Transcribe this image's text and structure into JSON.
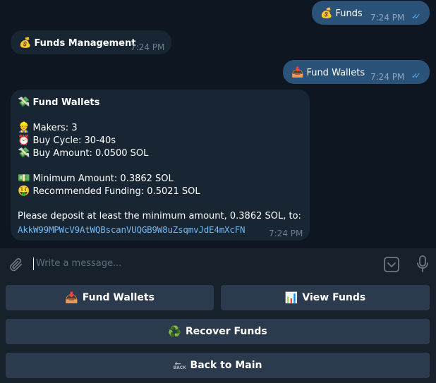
{
  "messages": {
    "m1": {
      "icon": "money-bag-icon",
      "emoji": "💰",
      "text": "Funds",
      "time": "7:24 PM",
      "checks": "✓✓"
    },
    "m2": {
      "icon": "money-bag-icon",
      "emoji": "💰",
      "text": "Funds Management",
      "time": "7:24 PM"
    },
    "m3": {
      "icon": "inbox-tray-icon",
      "emoji": "📥",
      "text": "Fund Wallets",
      "time": "7:24 PM",
      "checks": "✓✓"
    },
    "m4": {
      "title_emoji": "💸",
      "title": "Fund Wallets",
      "makers_emoji": "👷",
      "makers": "Makers: 3",
      "cycle_emoji": "⏰",
      "cycle": "Buy Cycle: 30-40s",
      "amount_emoji": "💸",
      "amount": "Buy Amount: 0.0500 SOL",
      "min_emoji": "💵",
      "min": "Minimum Amount: 0.3862 SOL",
      "rec_emoji": "🤑",
      "rec": "Recommended Funding: 0.5021 SOL",
      "deposit": "Please deposit at least the minimum amount, 0.3862 SOL, to:",
      "address": "AkkW99MPWcV9AtWQBscanVUQGB9W8uZsqmvJdE4mXcFN",
      "time": "7:24 PM"
    }
  },
  "input": {
    "placeholder": "Write a message..."
  },
  "keyboard": {
    "fund_wallets": {
      "emoji": "📥",
      "label": "Fund Wallets"
    },
    "view_funds": {
      "emoji": "📊",
      "label": "View Funds"
    },
    "recover_funds": {
      "emoji": "♻️",
      "label": "Recover Funds"
    },
    "back_to_main": {
      "icon_text": "BACK",
      "icon_arrow": "←",
      "label": "Back to Main"
    }
  },
  "colors": {
    "background": "#0e1621",
    "outgoing_bubble": "#2b5278",
    "incoming_bubble": "#182533",
    "link": "#71baf4",
    "keyboard_button": "#2b3b4d"
  }
}
